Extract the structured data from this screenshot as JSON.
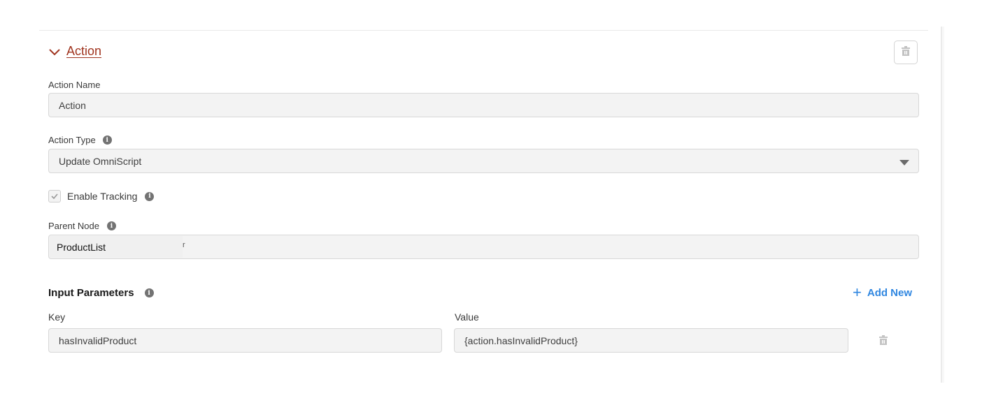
{
  "section": {
    "title": "Action",
    "expanded": true
  },
  "fields": {
    "action_name": {
      "label": "Action Name",
      "value": "Action"
    },
    "action_type": {
      "label": "Action Type",
      "value": "Update OmniScript"
    },
    "enable_tracking": {
      "label": "Enable Tracking",
      "checked": true
    },
    "parent_node": {
      "label": "Parent Node",
      "value": "ProductList",
      "trailing": "r"
    }
  },
  "input_parameters": {
    "title": "Input Parameters",
    "add_label": "Add New",
    "key_header": "Key",
    "value_header": "Value",
    "rows": [
      {
        "key": "hasInvalidProduct",
        "value": "{action.hasInvalidProduct}"
      }
    ]
  },
  "icons": {
    "section_toggle": "chevron-down-icon",
    "delete": "trash-icon",
    "info": "info-icon",
    "add": "plus-icon",
    "checkbox": "check-icon",
    "select": "triangle-down-icon"
  },
  "colors": {
    "section_title": "#a0341f",
    "link_accent": "#2f86e0",
    "input_bg": "#f3f3f3",
    "icon_gray": "#737373"
  }
}
